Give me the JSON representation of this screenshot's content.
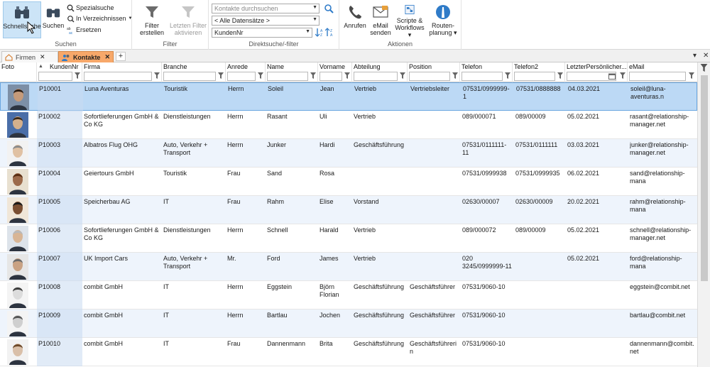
{
  "ribbon": {
    "schnellsuche": "Schnellsuche",
    "suchen": "Suchen",
    "spezialsuche": "Spezialsuche",
    "in_verzeichnissen": "In Verzeichnissen",
    "ersetzen": "Ersetzen",
    "group_suchen": "Suchen",
    "filter_erstellen": [
      "Filter",
      "erstellen"
    ],
    "letzten_filter": [
      "Letzten Filter",
      "aktivieren"
    ],
    "group_filter": "Filter",
    "search_placeholder": "Kontakte durchsuchen",
    "datasets_value": "< Alle Datensätze >",
    "field_value": "KundenNr",
    "group_direkt": "Direktsuche/-filter",
    "anrufen": "Anrufen",
    "email_senden": [
      "eMail",
      "senden"
    ],
    "scripte": [
      "Scripte &",
      "Workflows"
    ],
    "routen": [
      "Routen-",
      "planung"
    ],
    "group_aktionen": "Aktionen"
  },
  "tabs": [
    {
      "label": "Firmen",
      "active": false
    },
    {
      "label": "Kontakte",
      "active": true
    }
  ],
  "columns": [
    "Foto",
    "KundenNr",
    "Firma",
    "Branche",
    "Anrede",
    "Name",
    "Vorname",
    "Abteilung",
    "Position",
    "Telefon",
    "Telefon2",
    "LetzterPersönlicher...",
    "eMail"
  ],
  "rows": [
    {
      "kundennr": "P10001",
      "firma": "Luna Aventuras",
      "branche": "Touristik",
      "anrede": "Herrn",
      "name": "Soleil",
      "vorname": "Jean",
      "abteilung": "Vertrieb",
      "position": "Vertriebsleiter",
      "telefon": "07531/0999999-1",
      "telefon2": "07531/0888888",
      "letzter": "04.03.2021",
      "email": "soleil@luna-aventuras.n"
    },
    {
      "kundennr": "P10002",
      "firma": "Sofortlieferungen GmbH & Co KG",
      "branche": "Dienstleistungen",
      "anrede": "Herrn",
      "name": "Rasant",
      "vorname": "Uli",
      "abteilung": "Vertrieb",
      "position": "",
      "telefon": "089/000071",
      "telefon2": "089/00009",
      "letzter": "05.02.2021",
      "email": "rasant@relationship-manager.net"
    },
    {
      "kundennr": "P10003",
      "firma": "Albatros Flug OHG",
      "branche": "Auto, Verkehr + Transport",
      "anrede": "Herrn",
      "name": "Junker",
      "vorname": "Hardi",
      "abteilung": "Geschäftsführung",
      "position": "",
      "telefon": "07531/0111111-11",
      "telefon2": "07531/0111111",
      "letzter": "03.03.2021",
      "email": "junker@relationship-manager.net"
    },
    {
      "kundennr": "P10004",
      "firma": "Geiertours GmbH",
      "branche": "Touristik",
      "anrede": "Frau",
      "name": "Sand",
      "vorname": "Rosa",
      "abteilung": "",
      "position": "",
      "telefon": "07531/0999938",
      "telefon2": "07531/0999935",
      "letzter": "06.02.2021",
      "email": "sand@relationship-mana"
    },
    {
      "kundennr": "P10005",
      "firma": "Speicherbau AG",
      "branche": "IT",
      "anrede": "Frau",
      "name": "Rahm",
      "vorname": "Elise",
      "abteilung": "Vorstand",
      "position": "",
      "telefon": "02630/00007",
      "telefon2": "02630/00009",
      "letzter": "20.02.2021",
      "email": "rahm@relationship-mana"
    },
    {
      "kundennr": "P10006",
      "firma": "Sofortlieferungen GmbH & Co KG",
      "branche": "Dienstleistungen",
      "anrede": "Herrn",
      "name": "Schnell",
      "vorname": "Harald",
      "abteilung": "Vertrieb",
      "position": "",
      "telefon": "089/000072",
      "telefon2": "089/00009",
      "letzter": "05.02.2021",
      "email": "schnell@relationship-manager.net"
    },
    {
      "kundennr": "P10007",
      "firma": "UK Import Cars",
      "branche": "Auto, Verkehr + Transport",
      "anrede": "Mr.",
      "name": "Ford",
      "vorname": "James",
      "abteilung": "Vertrieb",
      "position": "",
      "telefon": "020 3245/0999999-11",
      "telefon2": "",
      "letzter": "05.02.2021",
      "email": "ford@relationship-mana"
    },
    {
      "kundennr": "P10008",
      "firma": "combit GmbH",
      "branche": "IT",
      "anrede": "Herrn",
      "name": "Eggstein",
      "vorname": "Björn Florian",
      "abteilung": "Geschäftsführung",
      "position": "Geschäftsführer",
      "telefon": "07531/9060-10",
      "telefon2": "",
      "letzter": "",
      "email": "eggstein@combit.net"
    },
    {
      "kundennr": "P10009",
      "firma": "combit GmbH",
      "branche": "IT",
      "anrede": "Herrn",
      "name": "Bartlau",
      "vorname": "Jochen",
      "abteilung": "Geschäftsführung",
      "position": "Geschäftsführer",
      "telefon": "07531/9060-10",
      "telefon2": "",
      "letzter": "",
      "email": "bartlau@combit.net"
    },
    {
      "kundennr": "P10010",
      "firma": "combit GmbH",
      "branche": "IT",
      "anrede": "Frau",
      "name": "Dannenmann",
      "vorname": "Brita",
      "abteilung": "Geschäftsführung",
      "position": "Geschäftsführerin",
      "telefon": "07531/9060-10",
      "telefon2": "",
      "letzter": "",
      "email": "dannenmann@combit.net"
    }
  ],
  "colors": {
    "accent": "#2f7bc8",
    "tab_active": "#f7a86a",
    "selection": "#bcd9f5"
  }
}
